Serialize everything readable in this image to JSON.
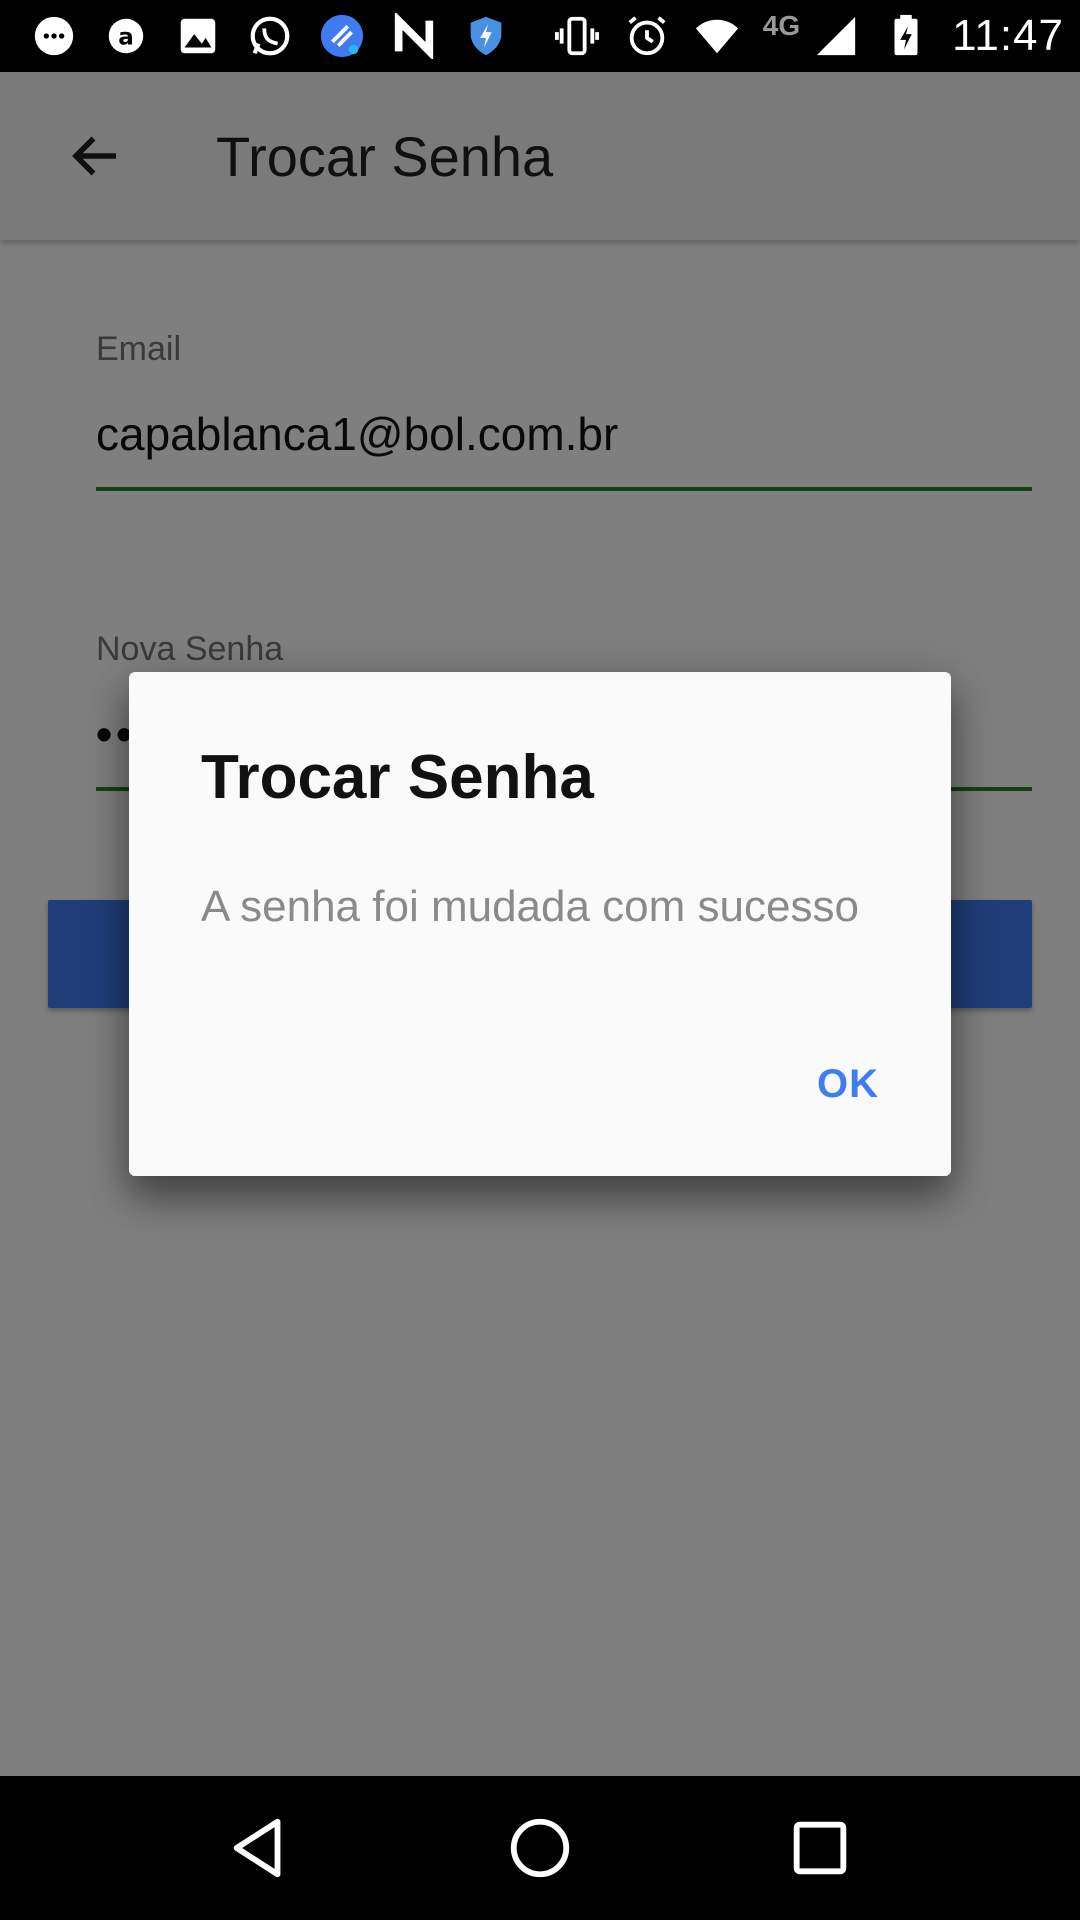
{
  "status_bar": {
    "network": "4G",
    "time": "11:47",
    "icons": [
      "messaging-icon",
      "avast-icon",
      "gallery-icon",
      "whatsapp-icon",
      "cleaner-icon",
      "n-app-icon",
      "shield-icon",
      "vibrate-icon",
      "alarm-icon",
      "wifi-icon",
      "signal-icon",
      "battery-charging-icon"
    ]
  },
  "app_bar": {
    "title": "Trocar Senha",
    "back_icon": "arrow-back-icon"
  },
  "form": {
    "email_label": "Email",
    "email_value": "capablanca1@bol.com.br",
    "password_label": "Nova Senha",
    "password_value": "••"
  },
  "dialog": {
    "title": "Trocar Senha",
    "message": "A senha foi mudada com sucesso",
    "ok_label": "OK"
  },
  "nav_bar": {
    "back": "nav-back-icon",
    "home": "nav-home-icon",
    "recents": "nav-recents-icon"
  },
  "colors": {
    "accent": "#3f7cf2",
    "field_underline": "#2e7d32",
    "scrim": "rgba(0,0,0,0.5)"
  }
}
